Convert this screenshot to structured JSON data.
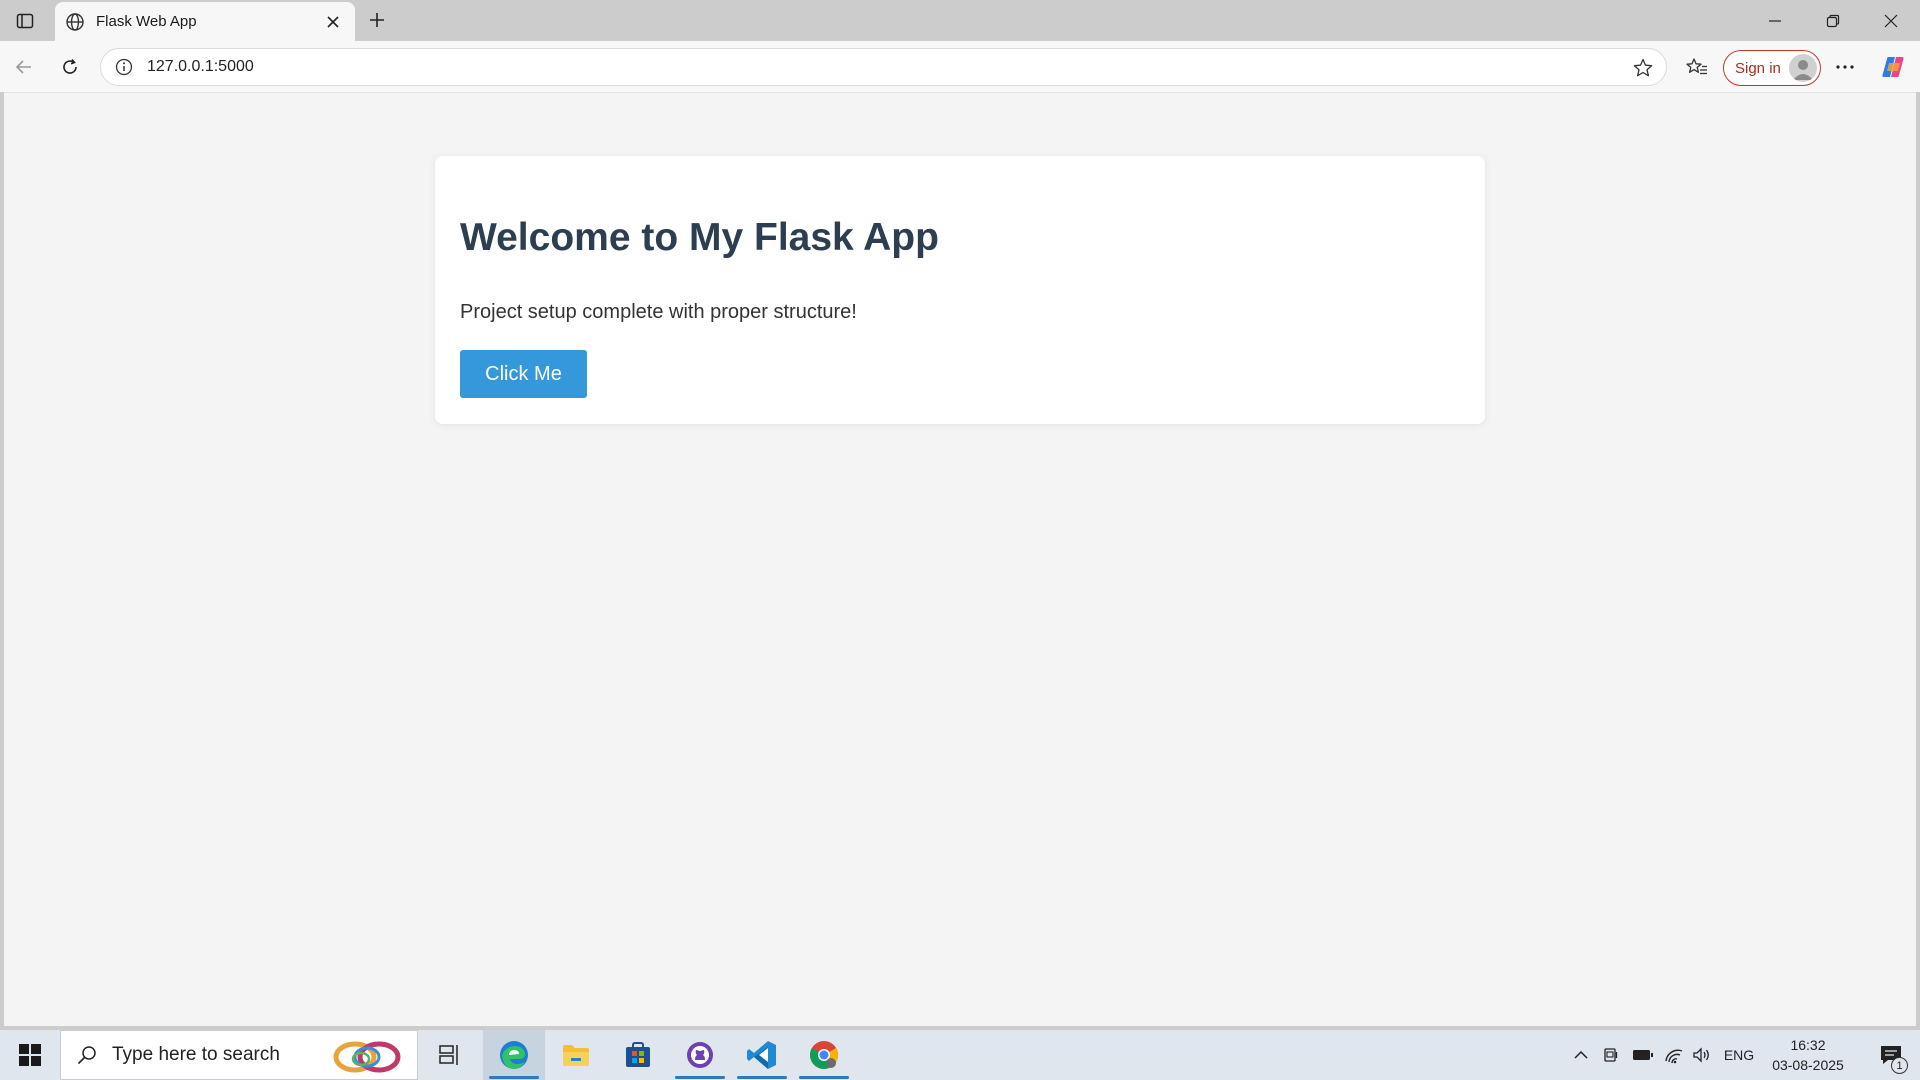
{
  "browser": {
    "tab": {
      "title": "Flask Web App",
      "favicon": "globe-icon"
    },
    "address": {
      "url": "127.0.0.1:5000"
    },
    "signin_label": "Sign in"
  },
  "page": {
    "title": "Welcome to My Flask App",
    "subtitle": "Project setup complete with proper structure!",
    "button_label": "Click Me",
    "colors": {
      "heading": "#2c3e50",
      "button": "#3498db",
      "background": "#f4f4f4"
    }
  },
  "taskbar": {
    "search_placeholder": "Type here to search",
    "apps": [
      "task-view-icon",
      "edge-icon",
      "file-explorer-icon",
      "store-icon",
      "github-desktop-icon",
      "vscode-icon",
      "chrome-icon"
    ],
    "language": "ENG",
    "time": "16:32",
    "date": "03-08-2025",
    "notification_count": "1"
  }
}
